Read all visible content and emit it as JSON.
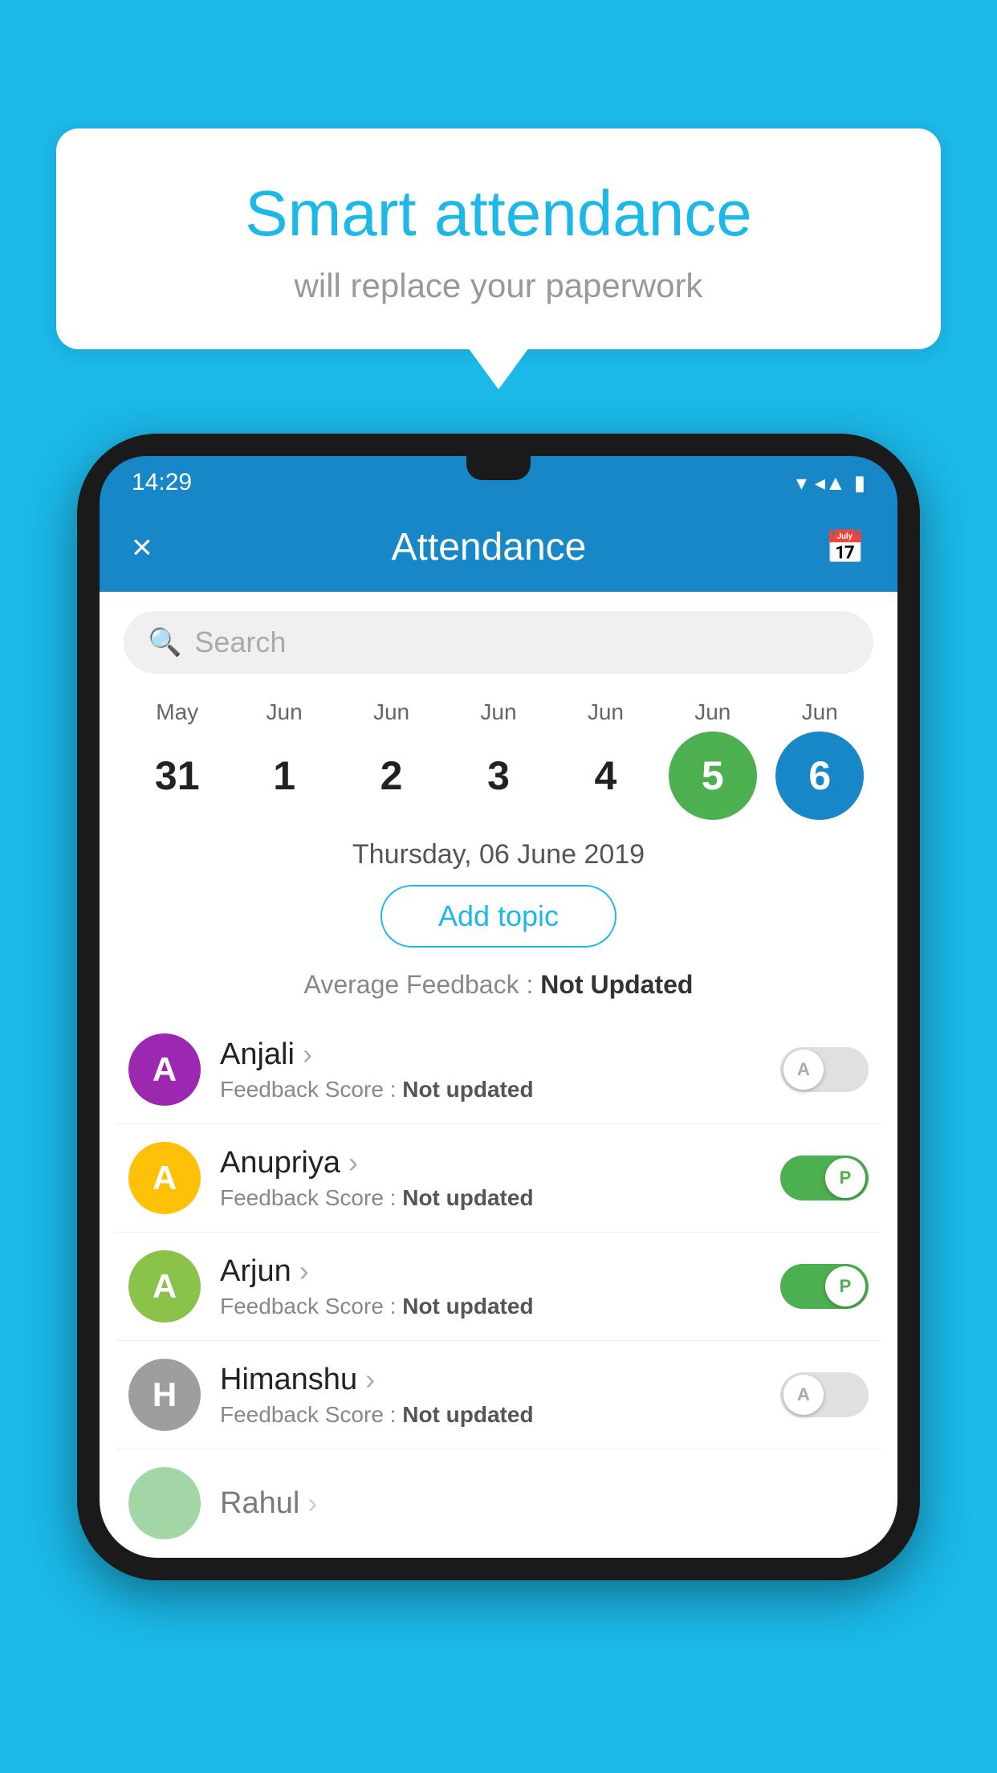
{
  "background_color": "#1BB8E8",
  "bubble": {
    "title": "Smart attendance",
    "subtitle": "will replace your paperwork"
  },
  "status_bar": {
    "time": "14:29",
    "icons": [
      "▼",
      "◂",
      "▮"
    ]
  },
  "header": {
    "title": "Attendance",
    "close_label": "×",
    "calendar_icon": "📅"
  },
  "search": {
    "placeholder": "Search"
  },
  "calendar": {
    "months": [
      "May",
      "Jun",
      "Jun",
      "Jun",
      "Jun",
      "Jun",
      "Jun"
    ],
    "dates": [
      "31",
      "1",
      "2",
      "3",
      "4",
      "5",
      "6"
    ],
    "today_index": 5,
    "selected_index": 6
  },
  "selected_date": "Thursday, 06 June 2019",
  "add_topic_label": "Add topic",
  "avg_feedback_label": "Average Feedback :",
  "avg_feedback_value": "Not Updated",
  "students": [
    {
      "name": "Anjali",
      "initial": "A",
      "avatar_color": "#9C27B0",
      "feedback_label": "Feedback Score :",
      "feedback_value": "Not updated",
      "attendance": "A",
      "present": false
    },
    {
      "name": "Anupriya",
      "initial": "A",
      "avatar_color": "#FFC107",
      "feedback_label": "Feedback Score :",
      "feedback_value": "Not updated",
      "attendance": "P",
      "present": true
    },
    {
      "name": "Arjun",
      "initial": "A",
      "avatar_color": "#8BC34A",
      "feedback_label": "Feedback Score :",
      "feedback_value": "Not updated",
      "attendance": "P",
      "present": true
    },
    {
      "name": "Himanshu",
      "initial": "H",
      "avatar_color": "#9E9E9E",
      "feedback_label": "Feedback Score :",
      "feedback_value": "Not updated",
      "attendance": "A",
      "present": false
    }
  ]
}
